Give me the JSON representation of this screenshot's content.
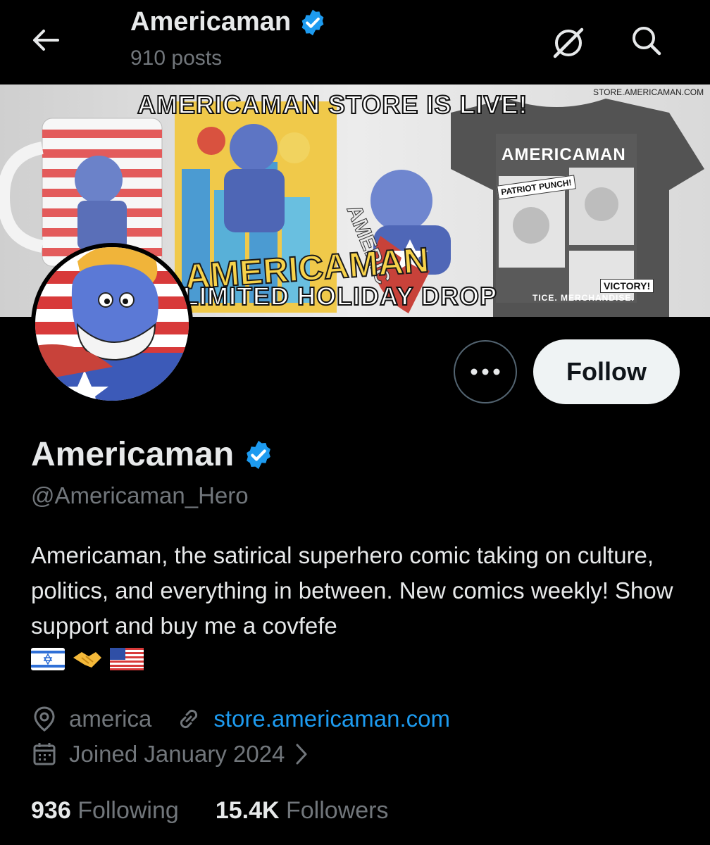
{
  "header": {
    "title": "Americaman",
    "post_count": "910 posts"
  },
  "banner": {
    "headline": "AMERICAMAN STORE IS LIVE!",
    "url": "STORE.AMERICAMAN.COM",
    "mascot_word": "AMERICAMAN",
    "footer": "LIMITED HOLIDAY DROP",
    "shirt_title": "AMERICAMAN",
    "shirt_badge": "PATRIOT PUNCH!",
    "shirt_victory": "VICTORY!",
    "shirt_merch": "TICE. MERCHANDISE."
  },
  "actions": {
    "follow_label": "Follow",
    "more_icon": "ellipsis-icon"
  },
  "profile": {
    "display_name": "Americaman",
    "handle": "@Americaman_Hero",
    "bio": "Americaman, the satirical superhero comic taking on culture, politics, and everything in between. New comics weekly! Show support and buy me a covfefe",
    "bio_emojis": [
      "flag-israel",
      "handshake",
      "flag-usa"
    ],
    "location": "america",
    "website": "store.americaman.com",
    "joined": "Joined January 2024"
  },
  "stats": {
    "following_count": "936",
    "following_label": "Following",
    "followers_count": "15.4K",
    "followers_label": "Followers"
  },
  "colors": {
    "background": "#000000",
    "text_primary": "#e7e9ea",
    "text_secondary": "#71767b",
    "link": "#1d9bf0",
    "verified": "#1d9bf0",
    "follow_bg": "#eff3f4"
  }
}
